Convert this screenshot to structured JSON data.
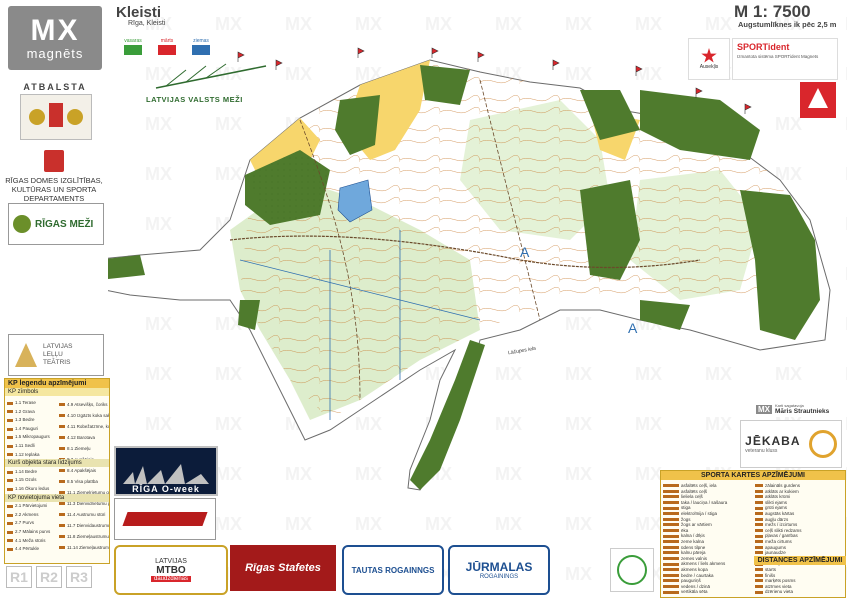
{
  "header": {
    "title": "Kleisti",
    "subtitle": "Rīga, Kleisti",
    "scale": "M 1: 7500",
    "contour": "Augstumlīknes ik pēc 2,5 m"
  },
  "sidebar": {
    "logo_top": "MX",
    "logo_bottom": "magnēts",
    "atbalsta": "ATBALSTA",
    "department": "RĪGAS DOMES IZGLĪTĪBAS, KULTŪRAS UN SPORTA DEPARTAMENTS",
    "riga_mezi": "RĪGAS MEŽI",
    "theatre_line1": "LATVIJAS",
    "theatre_line2": "LEĻĻU",
    "theatre_line3": "TEĀTRIS"
  },
  "magnets_brands": [
    "vasaras",
    "mārts",
    "ziemas"
  ],
  "forest_logo_text": "LATVIJAS VALSTS MEŽI",
  "legend": {
    "title": "KP legendu apzīmējumi",
    "kp_title": "KP zīmbols",
    "sub1": "Kurš objekta stara līdzījums",
    "sub2": "KP novietojuma vieta",
    "col1": [
      "1.1 Terase",
      "1.2 Grava",
      "1.3 Bedre",
      "1.4 Pauguri",
      "1.5 Mikropaugurs",
      "1.11 Sedli",
      "1.12 Ieplaka",
      "1.13 Maza ieplaka",
      "1.14 Bedre",
      "1.15 Ozols",
      "1.16 Ōkuro ledus",
      "1.8 Stūrs lielā akmeņu grupā",
      "2.1 Pārvietojumi",
      "2.2 Akmens",
      "2.7 Purvs",
      "2.7 Mālains purvs",
      "4.1 Meža stūris",
      "4.4 Pērtukle"
    ],
    "col2": [
      "4.9 Atsevišķs, čoriks koks",
      "4.10 Izgāzts koka sakne",
      "4.11 Robežatzīme, kupica",
      "4.12 Barotava",
      "8.1 Ziemeļu",
      "8.3 Augšējais",
      "8.4 Apakšējais",
      "8.5 Visa platība",
      "11.1 Ziemeļrietumu gals",
      "11.3 Dienvidrietumu gals",
      "11.4 Austrumu stūri",
      "11.7 Dienvidaustrumu gals",
      "11.8 Ziemeļaustrumu gals",
      "11.14 Ziemeļaustrumu puse"
    ]
  },
  "rounds": [
    "R1",
    "R2",
    "R3"
  ],
  "sponsors_top": {
    "sportident": "SPORTident",
    "sportident_sub": "Izmantota sistēma SPORTident Magnets",
    "ausekls": "Ausekļis"
  },
  "event_logos": {
    "riga_oweek": "RĪGA O-week",
    "mtbo_line1": "LATVIJAS",
    "mtbo_line2": "MTBO",
    "mtbo_line3": "daudzdienas",
    "stafetes": "Rīgas Stafetes",
    "tautas": "TAUTAS ROGAINNGS",
    "jurmalas": "JŪRMALAS",
    "jurmalas_sub": "ROGAININGS"
  },
  "credits": {
    "label": "Karti sagatavoja",
    "author": "Māris Strautnieks",
    "jekaba": "JĒKABA",
    "jekaba_sub": "veteranu kluss"
  },
  "map_legend": {
    "title": "SPORTA KARTES APZĪMĒJUMI",
    "distances": "DISTANCES APZĪMĒJUMI",
    "left": [
      "asfaltēts ceļš, iela",
      "asfaltēts ceļš",
      "lieliela ceļš",
      "taka / lauciņa / sašaura",
      "stiga",
      "elektrolīnija / stiga",
      "žogs",
      "žogs ar vārtiem",
      "ēka",
      "kalna / dīķis",
      "zeme kalna",
      "ūdens tilpne",
      "kalnu pāreja",
      "zemes valnis",
      "akmens / liels akmens",
      "akmens kopa",
      "bedre / caurtaka",
      "pauguriņš",
      "vedens / dzinā",
      "vertikāla sēta"
    ],
    "right": [
      "zālaināls gurdens",
      "atklāts ar kokiem",
      "atklāts krūmi",
      "slikti ejams",
      "grūti ejams",
      "augstās kārtas",
      "augļu dārzs",
      "mežs / izcirtums",
      "ceļš slikti redzams",
      "pļavas / ganības",
      "meža cirtums",
      "apaugums",
      "jaunaudze",
      "cits",
      "kontrolpunkts",
      "starts",
      "finišs",
      "marķēts posms",
      "atzīmes vieta",
      "dzērienu vieta"
    ]
  },
  "map_text": {
    "label_A1": "A",
    "label_A2": "A",
    "river_label": "Lāčupes iela"
  },
  "colors": {
    "forest_dark": "#4f7b2d",
    "forest_light": "#cfe6b7",
    "open_yellow": "#f7d66c",
    "water": "#6fa8dc",
    "contour": "#b86a1d",
    "magnets_red": "#d9262c",
    "frame_gray": "#8a8a8a"
  }
}
